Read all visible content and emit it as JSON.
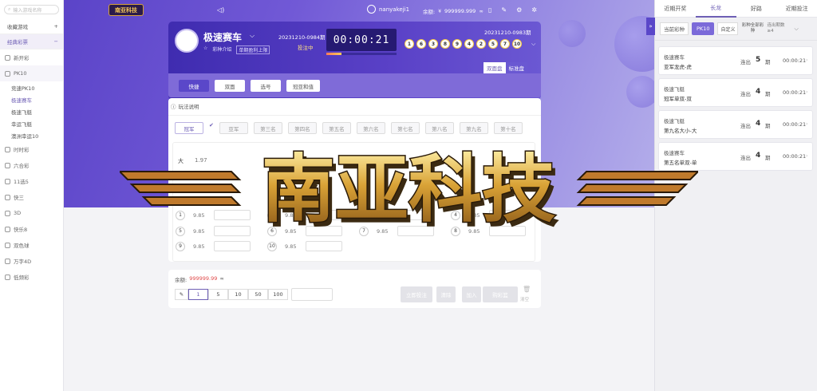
{
  "sidebar": {
    "search_placeholder": "输入游戏名称",
    "favorites": "收藏游戏",
    "classic": "经典彩票",
    "categories": [
      "新开彩",
      "PK10",
      "时时彩",
      "六合彩",
      "11选5",
      "快三",
      "3D",
      "快乐8",
      "双色球",
      "万字4D",
      "低频彩"
    ],
    "pk10_items": [
      "竞速PK10",
      "极速赛车",
      "极速飞艇",
      "幸运飞艇",
      "澳洲幸运10"
    ]
  },
  "topbar": {
    "logo": "南亚科技",
    "username": "nanyakeji1",
    "balance_label": "余额:",
    "balance": "999999.999"
  },
  "game": {
    "name": "极速赛车",
    "intro": "彩种介绍",
    "rule_tag": "单期盈利上限",
    "current_issue": "20231210-0984期",
    "status": "投注中",
    "countdown": "00:00:21",
    "last_issue": "20231210-0983期",
    "balls": [
      "1",
      "6",
      "3",
      "8",
      "9",
      "4",
      "2",
      "5",
      "7",
      "10"
    ],
    "views": [
      "双面盘",
      "标准盘"
    ]
  },
  "play_tabs": [
    "快捷",
    "双面",
    "选号",
    "冠亚和值"
  ],
  "rules_link": "玩法说明",
  "positions": [
    "冠军",
    "亚军",
    "第三名",
    "第四名",
    "第五名",
    "第六名",
    "第七名",
    "第八名",
    "第九名",
    "第十名"
  ],
  "odds": {
    "big_label": "大",
    "big_odds": "1.97",
    "rows": [
      [
        "1",
        "9.85",
        "2",
        "9.85",
        "3",
        "9.85",
        "4",
        "9.85"
      ],
      [
        "5",
        "9.85",
        "6",
        "9.85",
        "7",
        "9.85",
        "8",
        "9.85"
      ],
      [
        "9",
        "9.85",
        "10",
        "9.85"
      ]
    ]
  },
  "betbar": {
    "balance_label": "余额:",
    "balance": "999999.99",
    "chips": [
      "1",
      "5",
      "10",
      "50",
      "100"
    ],
    "buttons": [
      "立即投注",
      "清除",
      "加入",
      "购彩篮"
    ],
    "trash": "清空"
  },
  "right": {
    "tabs": [
      "近期开奖",
      "长龙",
      "好路",
      "近期投注"
    ],
    "filters": [
      "当前彩种",
      "PK10",
      "自定义",
      "彩种全部彩种",
      "连出期数≥4"
    ],
    "cards": [
      {
        "game": "极速赛车",
        "item": "亚军龙虎-虎",
        "streak": "连出",
        "count": "5",
        "unit": "期",
        "time": "00:00:21"
      },
      {
        "game": "极速飞艇",
        "item": "冠军单双-双",
        "streak": "连出",
        "count": "4",
        "unit": "期",
        "time": "00:00:21"
      },
      {
        "game": "极速飞艇",
        "item": "第九名大小-大",
        "streak": "连出",
        "count": "4",
        "unit": "期",
        "time": "00:00:21"
      },
      {
        "game": "极速赛车",
        "item": "第五名单双-单",
        "streak": "连出",
        "count": "4",
        "unit": "期",
        "time": "00:00:21"
      }
    ]
  },
  "watermark": "南亚科技",
  "colors": {
    "accent": "#6e5fb5",
    "hero": "#5b44c8",
    "ball_ring": "#f6c948"
  }
}
